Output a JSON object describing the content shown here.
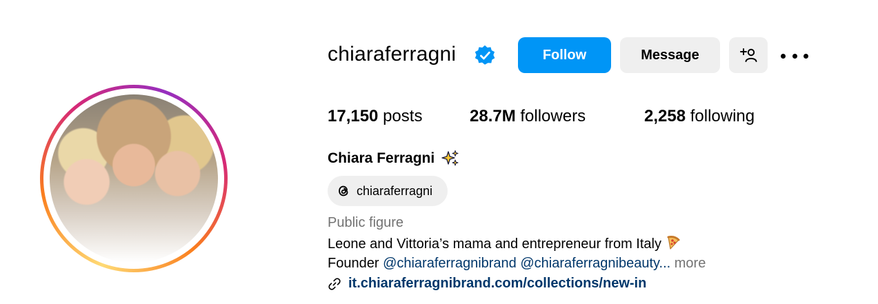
{
  "profile": {
    "username": "chiaraferragni",
    "full_name": "Chiara Ferragni",
    "threads_handle": "chiaraferragni",
    "category": "Public figure",
    "bio_line1": "Leone and Vittoria’s mama and entrepreneur from Italy",
    "bio_prefix": "Founder",
    "mention1": "@chiaraferragnibrand",
    "mention2": "@chiaraferragnibeauty",
    "ellipsis": "...",
    "more_label": "more",
    "website": "it.chiaraferragnibrand.com/collections/new-in"
  },
  "buttons": {
    "follow": "Follow",
    "message": "Message"
  },
  "stats": {
    "posts_count": "17,150",
    "posts_label": "posts",
    "followers_count": "28.7M",
    "followers_label": "followers",
    "following_count": "2,258",
    "following_label": "following"
  },
  "colors": {
    "follow_bg": "#0095f6",
    "verified": "#0095f6",
    "link": "#00376b",
    "muted": "#737373"
  },
  "icons": [
    "verified-badge-icon",
    "add-person-icon",
    "more-options-icon",
    "sparkles-icon",
    "threads-icon",
    "pizza-icon",
    "link-icon"
  ]
}
